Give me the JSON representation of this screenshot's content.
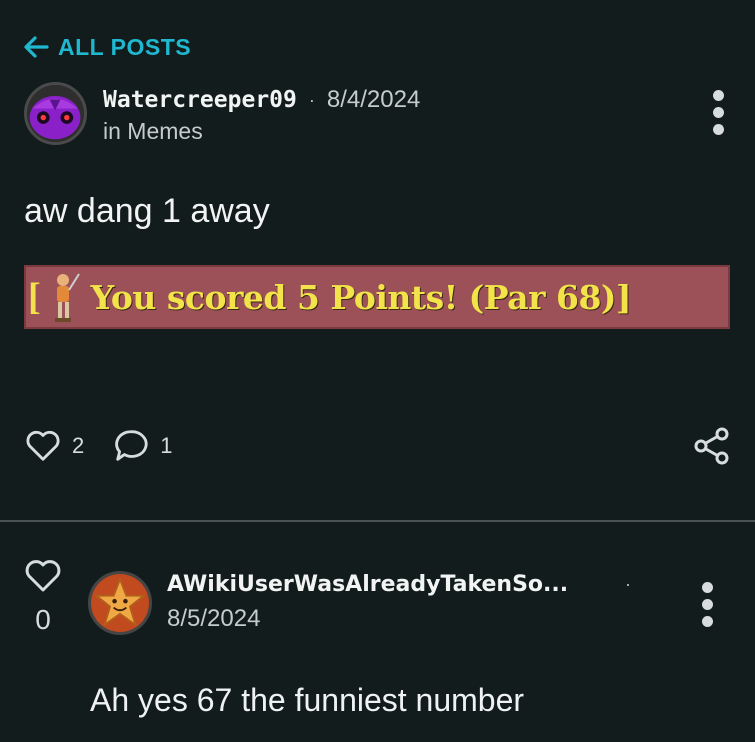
{
  "nav": {
    "back_label": "ALL POSTS",
    "back_icon": "arrow-left-icon"
  },
  "post": {
    "username": "Watercreeper09",
    "separator": "·",
    "date": "8/4/2024",
    "category": "in Memes",
    "text": "aw dang 1 away",
    "image": {
      "bracket_open": "[",
      "score_text": "You scored 5 Points! (Par 68)]"
    },
    "likes": "2",
    "comments": "1"
  },
  "comment": {
    "votes": "0",
    "username": "AWikiUserWasAlreadyTakenSo...",
    "separator": "·",
    "date": "8/5/2024",
    "text": "Ah yes 67 the funniest number"
  },
  "colors": {
    "background": "#121c1c",
    "accent": "#1fb8d0",
    "banner_bg": "#9c5158",
    "banner_text": "#f3e34a"
  }
}
